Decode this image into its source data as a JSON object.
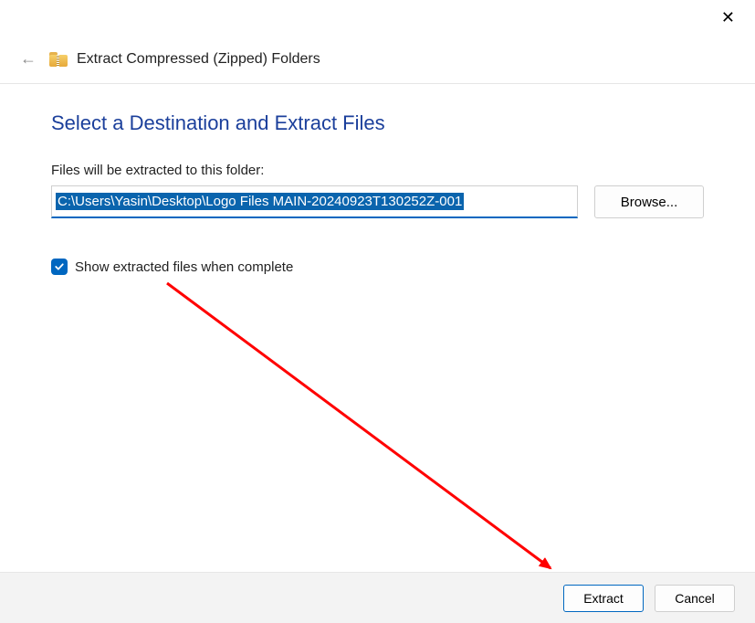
{
  "window": {
    "title": "Extract Compressed (Zipped) Folders"
  },
  "page": {
    "heading": "Select a Destination and Extract Files",
    "field_label": "Files will be extracted to this folder:",
    "path_value": "C:\\Users\\Yasin\\Desktop\\Logo Files MAIN-20240923T130252Z-001",
    "browse_label": "Browse...",
    "checkbox_label": "Show extracted files when complete",
    "checkbox_checked": true
  },
  "footer": {
    "extract_label": "Extract",
    "cancel_label": "Cancel"
  },
  "annotation": {
    "arrow_color": "#ff0000"
  }
}
